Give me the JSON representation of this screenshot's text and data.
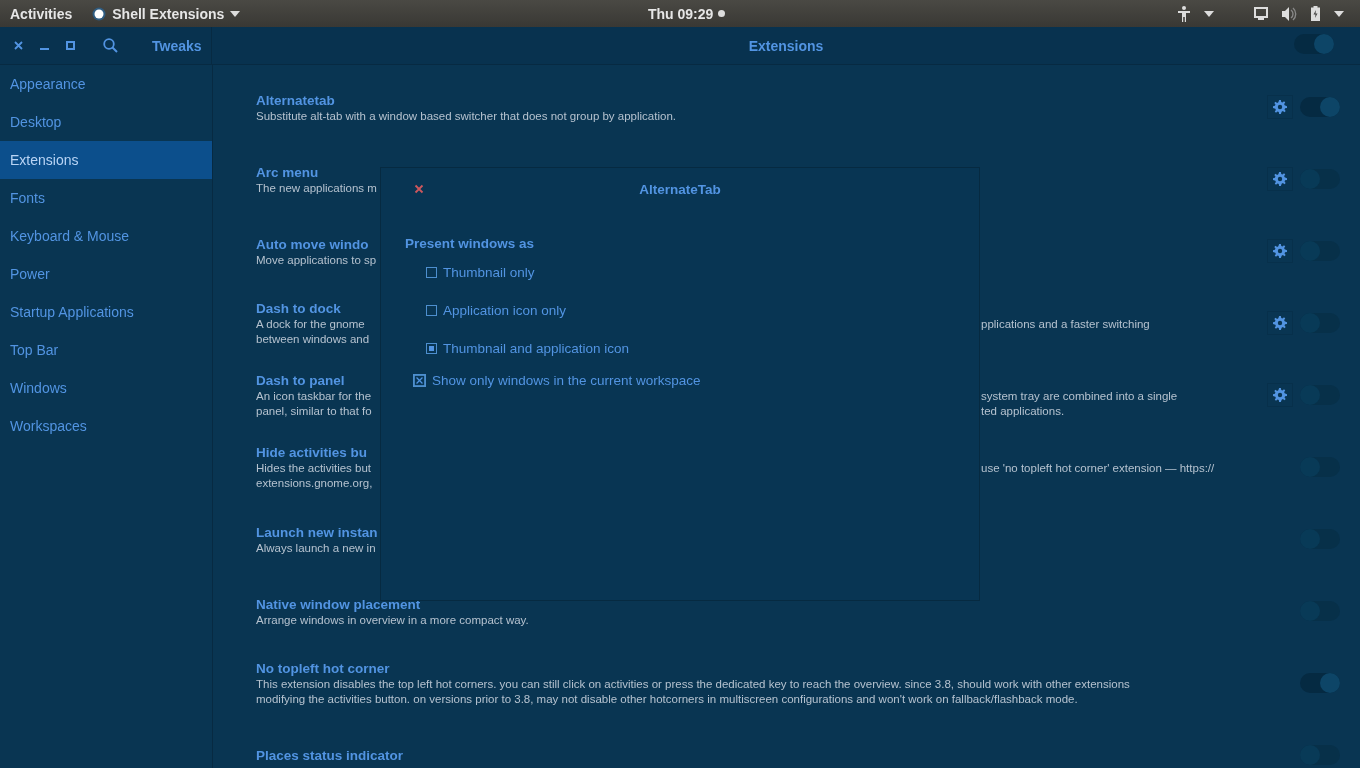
{
  "top_bar": {
    "activities": "Activities",
    "app_menu": "Shell Extensions",
    "clock": "Thu 09:29"
  },
  "header": {
    "sidebar_title": "Tweaks",
    "title": "Extensions",
    "extensions_on": true
  },
  "sidebar": {
    "items": [
      {
        "label": "Appearance",
        "selected": false
      },
      {
        "label": "Desktop",
        "selected": false
      },
      {
        "label": "Extensions",
        "selected": true
      },
      {
        "label": "Fonts",
        "selected": false
      },
      {
        "label": "Keyboard & Mouse",
        "selected": false
      },
      {
        "label": "Power",
        "selected": false
      },
      {
        "label": "Startup Applications",
        "selected": false
      },
      {
        "label": "Top Bar",
        "selected": false
      },
      {
        "label": "Windows",
        "selected": false
      },
      {
        "label": "Workspaces",
        "selected": false
      }
    ]
  },
  "extensions": [
    {
      "title": "Alternatetab",
      "description": [
        {
          "left": "Substitute alt-tab with a window based switcher that does not group by application."
        }
      ],
      "has_settings": true,
      "on": true
    },
    {
      "title": "Arc menu",
      "description": [
        {
          "left": "The new applications m"
        }
      ],
      "has_settings": true,
      "on": false
    },
    {
      "title": "Auto move windo",
      "description": [
        {
          "left": "Move applications to sp"
        }
      ],
      "has_settings": true,
      "on": false
    },
    {
      "title": "Dash to dock",
      "description": [
        {
          "left": "A dock for the gnome",
          "right": "pplications and a faster switching"
        },
        {
          "left": "between windows and"
        }
      ],
      "has_settings": true,
      "on": false
    },
    {
      "title": "Dash to panel",
      "description": [
        {
          "left": "An icon taskbar for the",
          "right": "system tray are combined into a single"
        },
        {
          "left": "panel, similar to that fo",
          "right": "ted applications."
        }
      ],
      "has_settings": true,
      "on": false
    },
    {
      "title": "Hide activities bu",
      "description": [
        {
          "left": "Hides the activities but",
          "right": "use 'no topleft hot corner' extension — https://"
        },
        {
          "left": "extensions.gnome.org,"
        }
      ],
      "has_settings": false,
      "on": false
    },
    {
      "title": "Launch new instan",
      "description": [
        {
          "left": "Always launch a new in"
        }
      ],
      "has_settings": false,
      "on": false
    },
    {
      "title": "Native window placement",
      "description": [
        {
          "left": "Arrange windows in overview in a more compact way."
        }
      ],
      "has_settings": false,
      "on": false
    },
    {
      "title": "No topleft hot corner",
      "description": [
        {
          "left": "This extension disables the top left hot corners. you can still click on activities or press the dedicated key to reach the overview. since 3.8, should work with other extensions"
        },
        {
          "left": "modifying the activities button. on versions prior to 3.8, may not disable other hotcorners in multiscreen configurations and won't work on fallback/flashback mode."
        }
      ],
      "has_settings": false,
      "on": true
    },
    {
      "title": "Places status indicator",
      "has_settings": false,
      "on": false
    }
  ],
  "dialog": {
    "title": "AlternateTab",
    "section": "Present windows as",
    "options": [
      {
        "label": "Thumbnail only",
        "selected": false
      },
      {
        "label": "Application icon only",
        "selected": false
      },
      {
        "label": "Thumbnail and application icon",
        "selected": true
      }
    ],
    "checkbox": {
      "label": "Show only windows in the current workspace",
      "checked": true
    }
  }
}
